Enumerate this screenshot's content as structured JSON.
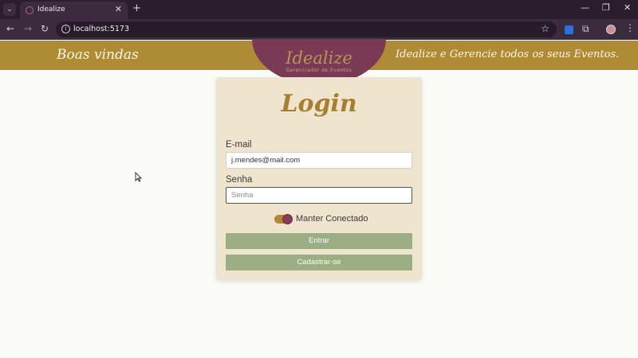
{
  "browser": {
    "tab_title": "Idealize",
    "tab_close": "✕",
    "new_tab": "+",
    "url": "localhost:5173",
    "win_min": "—",
    "win_restore": "❐",
    "win_close": "✕"
  },
  "header": {
    "left_text": "Boas vindas",
    "right_text": "Idealize e Gerencie todos os seus Eventos.",
    "logo_name": "Idealize",
    "logo_sub": "Gerenciador de Eventos",
    "colors": {
      "bar": "#b08b35",
      "logo_bg": "#7a3a56"
    }
  },
  "login": {
    "title": "Login",
    "email_label": "E-mail",
    "email_value": "j.mendes@mail.com",
    "password_label": "Senha",
    "password_placeholder": "Senha",
    "remember_label": "Manter Conectado",
    "remember_on": true,
    "submit_label": "Entrar",
    "register_label": "Cadastrar-se"
  },
  "icons": {
    "back": "arrow-left-icon",
    "forward": "arrow-right-icon",
    "reload": "reload-icon",
    "bookmark": "star-icon",
    "extensions": "puzzle-icon",
    "menu": "kebab-menu-icon"
  }
}
